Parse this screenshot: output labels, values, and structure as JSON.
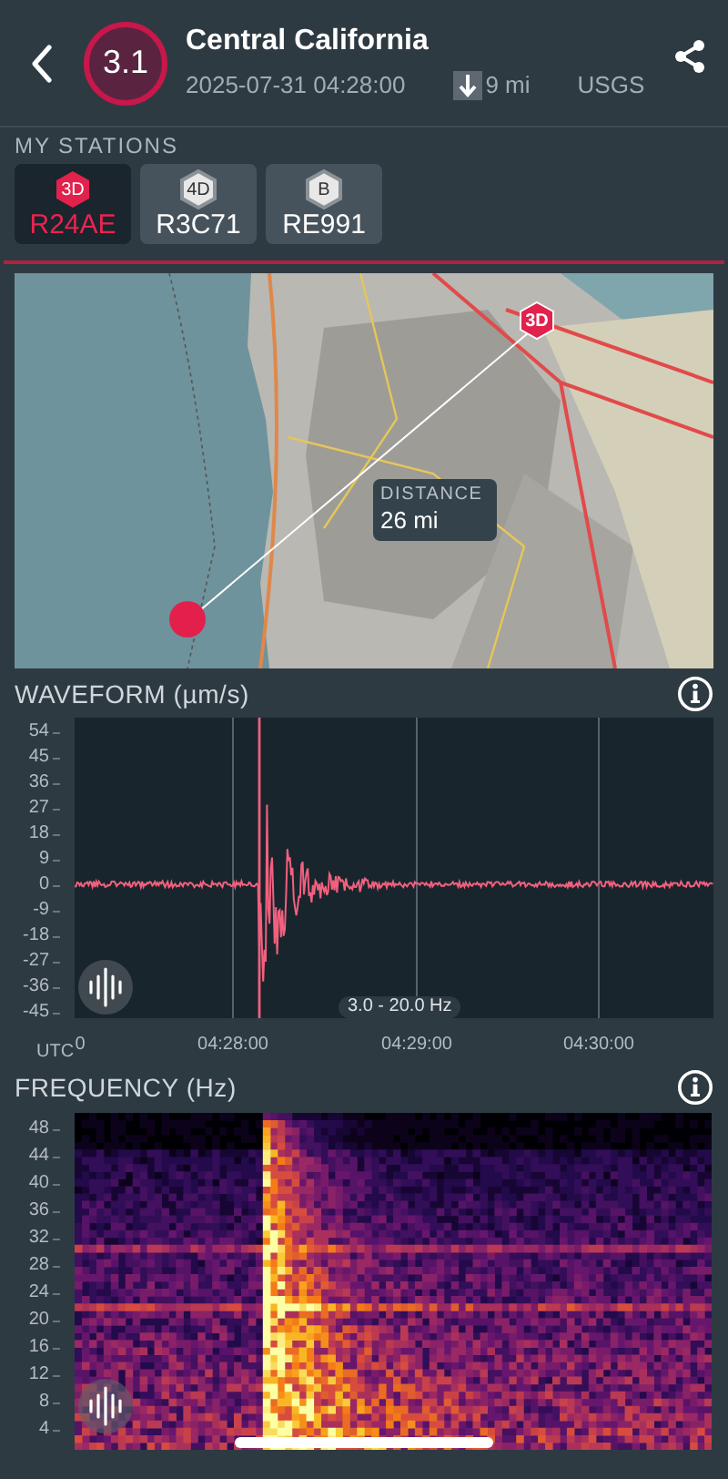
{
  "header": {
    "magnitude": "3.1",
    "title": "Central California",
    "datetime": "2025-07-31 04:28:00",
    "depth": "9 mi",
    "source": "USGS"
  },
  "stations_label": "MY STATIONS",
  "stations": [
    {
      "badge": "3D",
      "name": "R24AE",
      "selected": true
    },
    {
      "badge": "4D",
      "name": "R3C71",
      "selected": false
    },
    {
      "badge": "B",
      "name": "RE991",
      "selected": false
    }
  ],
  "map": {
    "marker": "3D",
    "distance_label": "DISTANCE",
    "distance": "26 mi"
  },
  "waveform": {
    "title": "WAVEFORM (µm/s)",
    "y_ticks": [
      "54",
      "45",
      "36",
      "27",
      "18",
      "9",
      "0",
      "-9",
      "-18",
      "-27",
      "-36",
      "-45"
    ],
    "x_axis_label": "UTC",
    "x_ticks": [
      "0",
      "04:28:00",
      "04:29:00",
      "04:30:00"
    ],
    "filter": "3.0 - 20.0 Hz"
  },
  "frequency": {
    "title": "FREQUENCY (Hz)",
    "y_ticks": [
      "48",
      "44",
      "40",
      "36",
      "32",
      "28",
      "24",
      "20",
      "16",
      "12",
      "8",
      "4"
    ]
  }
}
